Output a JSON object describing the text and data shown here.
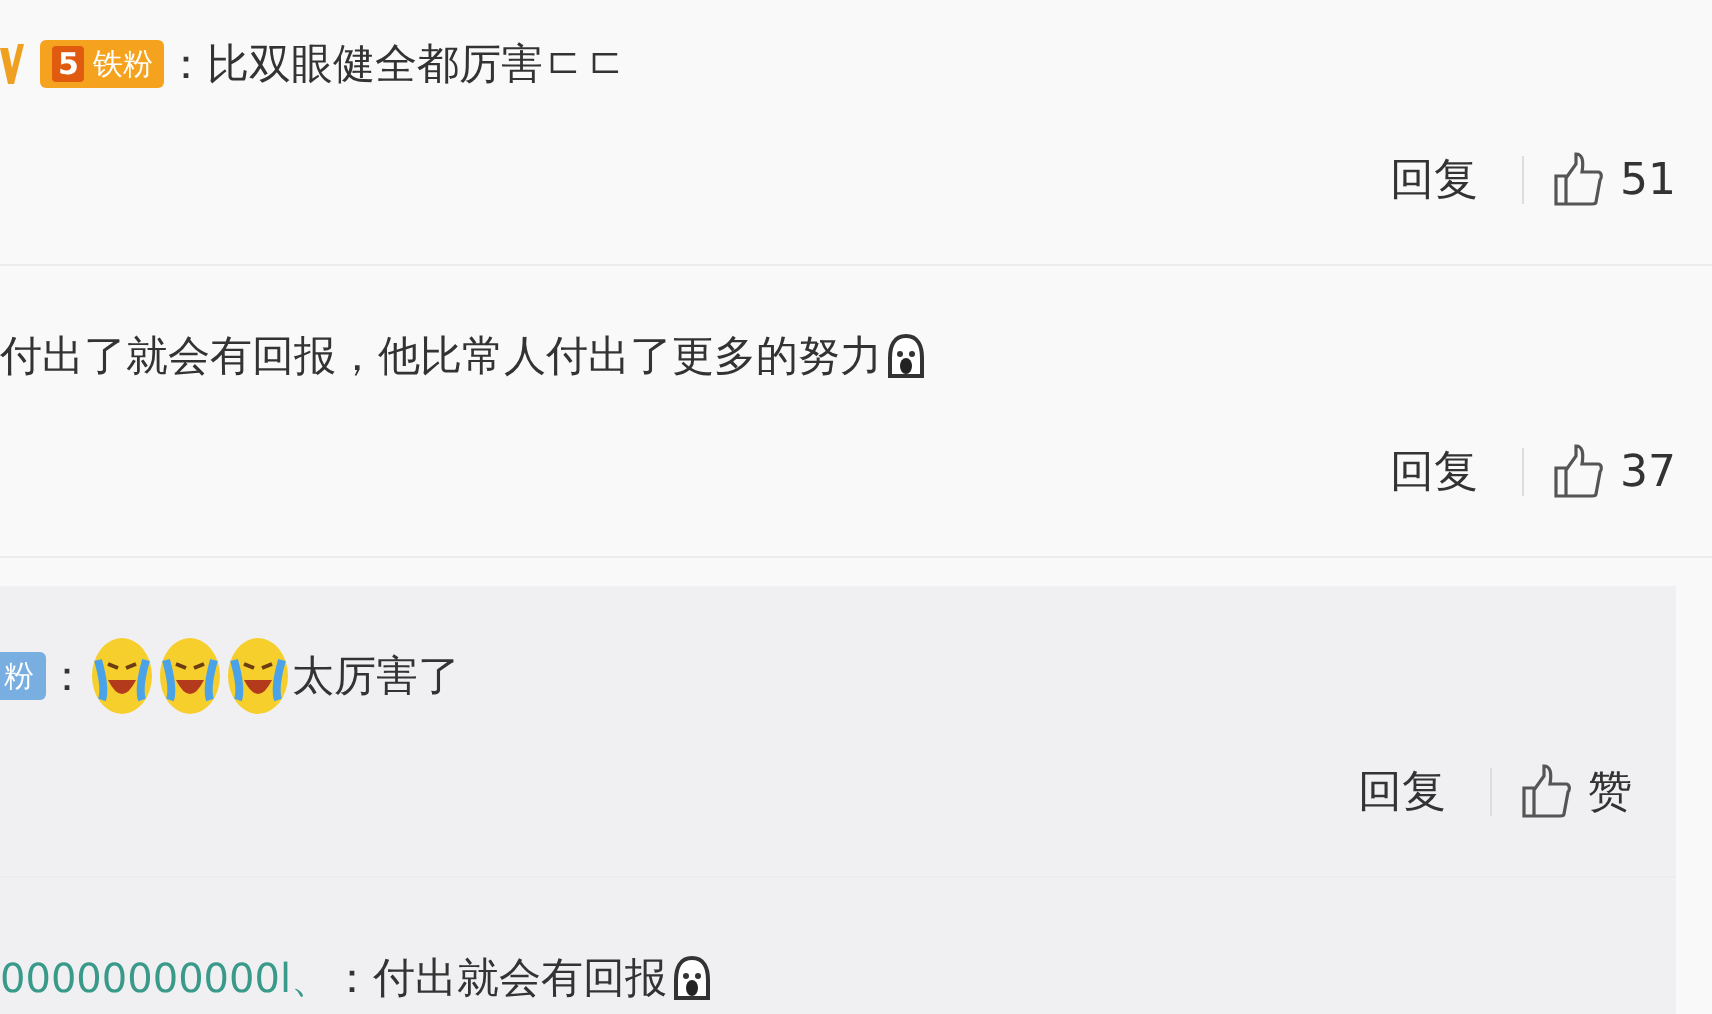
{
  "comments": [
    {
      "verified": true,
      "badge": {
        "label": "铁粉",
        "level": "5",
        "color": "#f5a21e"
      },
      "parts": [
        {
          "kind": "text",
          "text": "：比双眼健全都厉害ㄷㄷ"
        }
      ],
      "reply": "回复",
      "likes": "51"
    },
    {
      "verified": false,
      "parts": [
        {
          "kind": "text",
          "text": "付出了就会有回报，他比常人付出了更多的努力"
        },
        {
          "kind": "scream"
        }
      ],
      "reply": "回复",
      "likes": "37",
      "replies": [
        {
          "badge": {
            "label": "粉",
            "color": "#78aee0"
          },
          "parts": [
            {
              "kind": "text",
              "text": "："
            },
            {
              "kind": "laugh-cry"
            },
            {
              "kind": "laugh-cry"
            },
            {
              "kind": "laugh-cry"
            },
            {
              "kind": "text",
              "text": "太厉害了"
            }
          ],
          "reply": "回复",
          "likes": "赞"
        },
        {
          "user": "00000000000l、",
          "parts": [
            {
              "kind": "text",
              "text": "：付出就会有回报"
            },
            {
              "kind": "scream"
            }
          ]
        }
      ]
    }
  ]
}
